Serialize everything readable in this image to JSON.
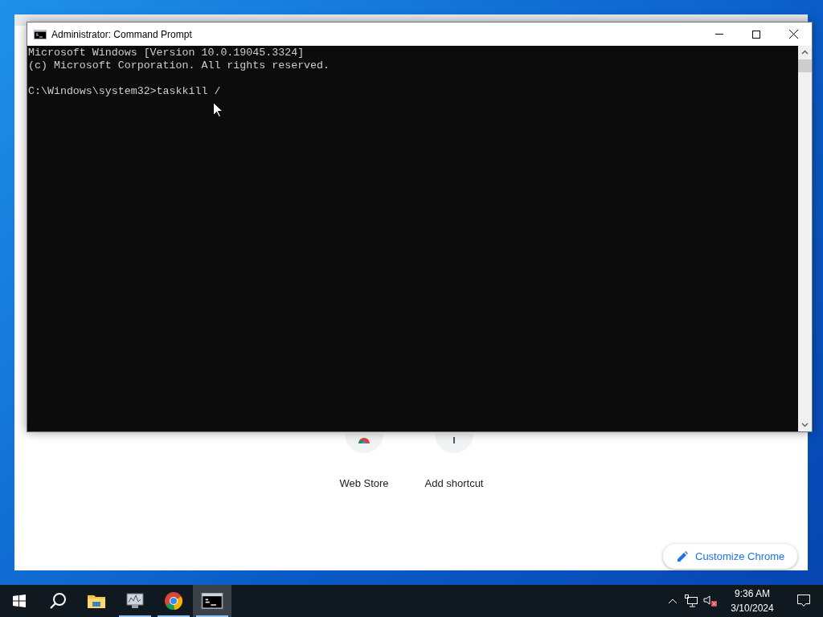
{
  "console_window": {
    "title": "Administrator: Command Prompt",
    "banner": [
      "Microsoft Windows [Version 10.0.19045.3324]",
      "(c) Microsoft Corporation. All rights reserved."
    ],
    "prompt": "C:\\Windows\\system32>taskkill /"
  },
  "browser_window": {
    "shortcuts": [
      {
        "kind": "store",
        "label": "Web Store"
      },
      {
        "kind": "add",
        "label": "Add shortcut"
      }
    ],
    "customize_button": "Customize Chrome"
  },
  "taskbar": {
    "apps": [
      {
        "kind": "explorer",
        "open": false,
        "selected": false
      },
      {
        "kind": "monitor",
        "open": true,
        "selected": false
      },
      {
        "kind": "chrome",
        "open": true,
        "selected": false
      },
      {
        "kind": "terminal",
        "open": true,
        "selected": true
      }
    ],
    "clock": {
      "time": "9:36 AM",
      "date": "3/10/2024"
    },
    "volume_muted": true
  }
}
